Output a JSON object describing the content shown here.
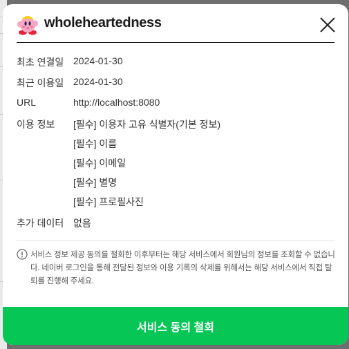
{
  "dialog": {
    "title": "wholeheartedness",
    "avatar_icon": "kirby-avatar-icon",
    "close_icon": "close-icon"
  },
  "details": {
    "first_connected_label": "최초 연결일",
    "first_connected_value": "2024-01-30",
    "last_used_label": "최근 이용일",
    "last_used_value": "2024-01-30",
    "url_label": "URL",
    "url_value": "http://localhost:8080",
    "usage_info_label": "이용 정보",
    "usage_info_items": [
      "[필수] 이용자 고유 식별자(기본 정보)",
      "[필수] 이름",
      "[필수] 이메일",
      "[필수] 별명",
      "[필수] 프로필사진"
    ],
    "extra_data_label": "추가 데이터",
    "extra_data_value": "없음"
  },
  "notice": {
    "icon": "info-circle-icon",
    "text": "서비스 정보 제공 동의를 철회한 이후부터는 해당 서비스에서 회원님의 정보를 조회할 수 없습니다. 네이버 로그인을 통해 전달된 정보와 이용 기록의 삭제를 위해서는 해당 서비스에서 직접 탈퇴를 진행해 주세요."
  },
  "actions": {
    "withdraw_label": "서비스 동의 철회"
  },
  "colors": {
    "accent": "#06c755",
    "overlay": "#6f6f6f"
  }
}
